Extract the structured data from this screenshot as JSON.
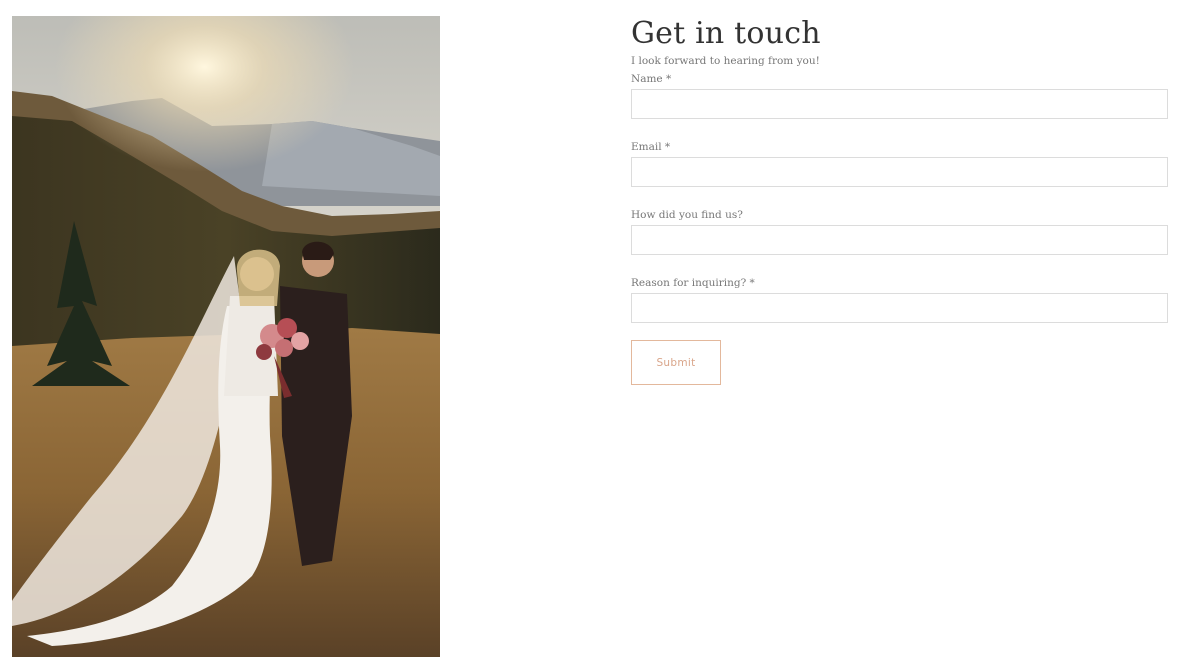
{
  "photo": {
    "alt": "bride-and-groom-mountain-meadow-photo"
  },
  "contact": {
    "title": "Get in touch",
    "subtitle": "I look forward to hearing from you!",
    "fields": [
      {
        "label": "Name *",
        "value": "",
        "placeholder": ""
      },
      {
        "label": "Email *",
        "value": "",
        "placeholder": ""
      },
      {
        "label": "How did you find us?",
        "value": "",
        "placeholder": ""
      },
      {
        "label": "Reason for inquiring? *",
        "value": "",
        "placeholder": ""
      }
    ],
    "submit_label": "Submit"
  },
  "colors": {
    "accent": "#e3b89c",
    "accent_text": "#d9a58a",
    "input_border": "#dcdcdc",
    "label_text": "#777777",
    "title_text": "#333333"
  }
}
